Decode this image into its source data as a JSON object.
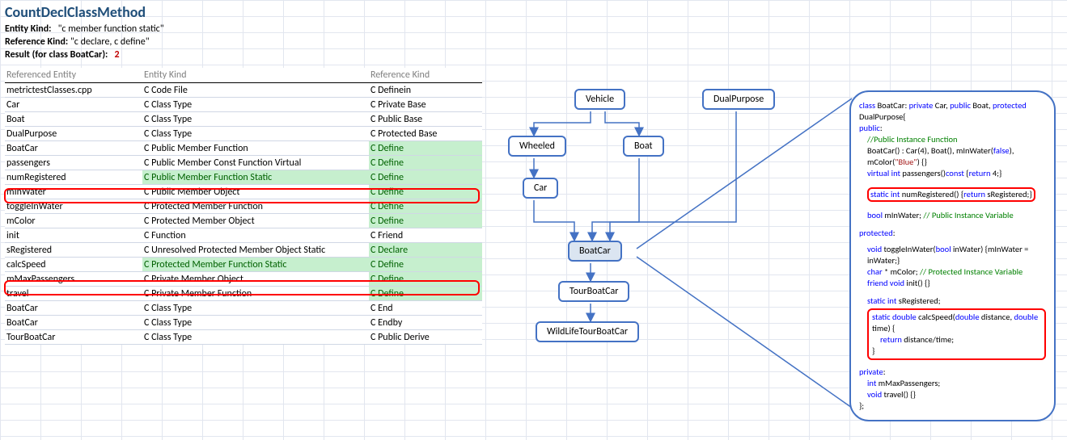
{
  "title": "CountDeclClassMethod",
  "meta": {
    "entity_kind_label": "Entity Kind:",
    "entity_kind_value": "\"c member function static\"",
    "reference_kind_label": "Reference Kind:",
    "reference_kind_value": "\"c declare, c define\"",
    "result_label": "Result  (for class BoatCar):",
    "result_value": "2"
  },
  "columns": {
    "entity": "Referenced Entity",
    "kind": "Entity Kind",
    "ref": "Reference Kind"
  },
  "rows": [
    {
      "entity": "metrictestClasses.cpp",
      "kind": "C Code File",
      "ref": "C Definein",
      "kind_hl": false,
      "ref_hl": false,
      "redbox": false
    },
    {
      "entity": "Car",
      "kind": "C Class Type",
      "ref": "C Private Base",
      "kind_hl": false,
      "ref_hl": false,
      "redbox": false
    },
    {
      "entity": "Boat",
      "kind": "C Class Type",
      "ref": "C Public Base",
      "kind_hl": false,
      "ref_hl": false,
      "redbox": false
    },
    {
      "entity": "DualPurpose",
      "kind": "C Class Type",
      "ref": "C Protected Base",
      "kind_hl": false,
      "ref_hl": false,
      "redbox": false
    },
    {
      "entity": "BoatCar",
      "kind": "C Public Member Function",
      "ref": "C Define",
      "kind_hl": false,
      "ref_hl": true,
      "redbox": false
    },
    {
      "entity": "passengers",
      "kind": "C Public Member Const Function Virtual",
      "ref": "C Define",
      "kind_hl": false,
      "ref_hl": true,
      "redbox": false
    },
    {
      "entity": "numRegistered",
      "kind": "C Public Member Function Static",
      "ref": "C Define",
      "kind_hl": true,
      "ref_hl": true,
      "redbox": true
    },
    {
      "entity": "mInWater",
      "kind": "C Public Member Object",
      "ref": "C Define",
      "kind_hl": false,
      "ref_hl": true,
      "redbox": false
    },
    {
      "entity": "toggleInWater",
      "kind": "C Protected Member Function",
      "ref": "C Define",
      "kind_hl": false,
      "ref_hl": true,
      "redbox": false
    },
    {
      "entity": "mColor",
      "kind": "C Protected Member Object",
      "ref": "C Define",
      "kind_hl": false,
      "ref_hl": true,
      "redbox": false
    },
    {
      "entity": "init",
      "kind": "C Function",
      "ref": "C Friend",
      "kind_hl": false,
      "ref_hl": false,
      "redbox": false
    },
    {
      "entity": "sRegistered",
      "kind": "C Unresolved Protected Member Object Static",
      "ref": "C Declare",
      "kind_hl": false,
      "ref_hl": true,
      "redbox": false
    },
    {
      "entity": "calcSpeed",
      "kind": "C Protected Member Function Static",
      "ref": "C Define",
      "kind_hl": true,
      "ref_hl": true,
      "redbox": true
    },
    {
      "entity": "mMaxPassengers",
      "kind": "C Private Member Object",
      "ref": "C Define",
      "kind_hl": false,
      "ref_hl": true,
      "redbox": false
    },
    {
      "entity": "travel",
      "kind": "C Private Member Function",
      "ref": "C Define",
      "kind_hl": false,
      "ref_hl": true,
      "redbox": false
    },
    {
      "entity": "BoatCar",
      "kind": "C Class Type",
      "ref": "C End",
      "kind_hl": false,
      "ref_hl": false,
      "redbox": false
    },
    {
      "entity": "BoatCar",
      "kind": "C Class Type",
      "ref": "C Endby",
      "kind_hl": false,
      "ref_hl": false,
      "redbox": false
    },
    {
      "entity": "TourBoatCar",
      "kind": "C Class Type",
      "ref": "C Public Derive",
      "kind_hl": false,
      "ref_hl": false,
      "redbox": false
    }
  ],
  "diagram": {
    "nodes": {
      "vehicle": "Vehicle",
      "dualpurpose": "DualPurpose",
      "wheeled": "Wheeled",
      "boat": "Boat",
      "car": "Car",
      "boatcar": "BoatCar",
      "tourboatcar": "TourBoatCar",
      "wildlife": "WildLifeTourBoatCar"
    }
  },
  "code": {
    "l1a": "class",
    "l1b": " BoatCar: ",
    "l1c": "private",
    "l1d": " Car, ",
    "l1e": "public",
    "l1f": " Boat, ",
    "l1g": "protected",
    "l1h": " DualPurpose{",
    "l2": "public",
    "l2s": ":",
    "l3": "//Public Instance Function",
    "l4a": "BoatCar() : Car(4), Boat(), mInWater(",
    "l4b": "false",
    "l4c": "), mColor(",
    "l4d": "\"Blue\"",
    "l4e": ") {}",
    "l5a": "virtual",
    "l5b": "int",
    "l5c": " passengers()",
    "l5d": "const",
    "l5e": " {",
    "l5f": "return",
    "l5g": " 4;}",
    "l6a": "static",
    "l6b": "int",
    "l6c": " numRegistered() {",
    "l6d": "return",
    "l6e": " sRegistered;}",
    "l7a": "bool",
    "l7b": " mInWater; ",
    "l7c": "// Public Instance Variable",
    "l8": "protected",
    "l8s": ":",
    "l9a": "void",
    "l9b": " toggleInWater(",
    "l9c": "bool",
    "l9d": " inWater) {mInWater = inWater;}",
    "l10a": "char",
    "l10b": " * mColor; ",
    "l10c": "// Protected Instance Variable",
    "l11a": "friend",
    "l11b": "void",
    "l11c": " init() {}",
    "l12a": "static",
    "l12b": "int",
    "l12c": " sRegistered;",
    "l13a": "static",
    "l13b": "double",
    "l13c": " calcSpeed(",
    "l13d": "double",
    "l13e": " distance, ",
    "l13f": "double",
    "l13g": " time) {",
    "l14a": "return",
    "l14b": " distance/time;",
    "l15": "}",
    "l16": "private",
    "l16s": ":",
    "l17a": "int",
    "l17b": " mMaxPassengers;",
    "l18a": "void",
    "l18b": " travel() {}",
    "l19": "};"
  }
}
